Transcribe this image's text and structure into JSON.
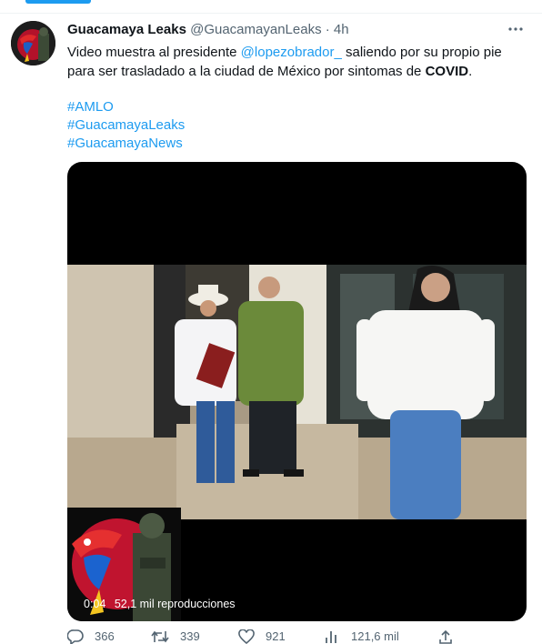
{
  "tweet": {
    "author_name": "Guacamaya Leaks",
    "author_handle": "@GuacamayanLeaks",
    "separator": "·",
    "time": "4h",
    "text_part1": "Video muestra al presidente ",
    "mention": "@lopezobrador_",
    "text_part2": " saliendo por su propio pie para ser trasladado a la ciudad de México por sintomas de ",
    "text_bold": "COVID",
    "text_end": ".",
    "hashtags": [
      "#AMLO",
      "#GuacamayaLeaks",
      "#GuacamayaNews"
    ]
  },
  "video": {
    "duration": "0:04",
    "views": "52,1 mil reproducciones"
  },
  "actions": {
    "replies": "366",
    "retweets": "339",
    "likes": "921",
    "views": "121,6 mil"
  },
  "icons": {
    "more": "more-options-icon",
    "reply": "reply-icon",
    "retweet": "retweet-icon",
    "like": "like-icon",
    "views": "analytics-icon",
    "share": "share-icon"
  },
  "colors": {
    "link": "#1d9bf0",
    "secondary_text": "#536471",
    "media_background": "#000000"
  }
}
